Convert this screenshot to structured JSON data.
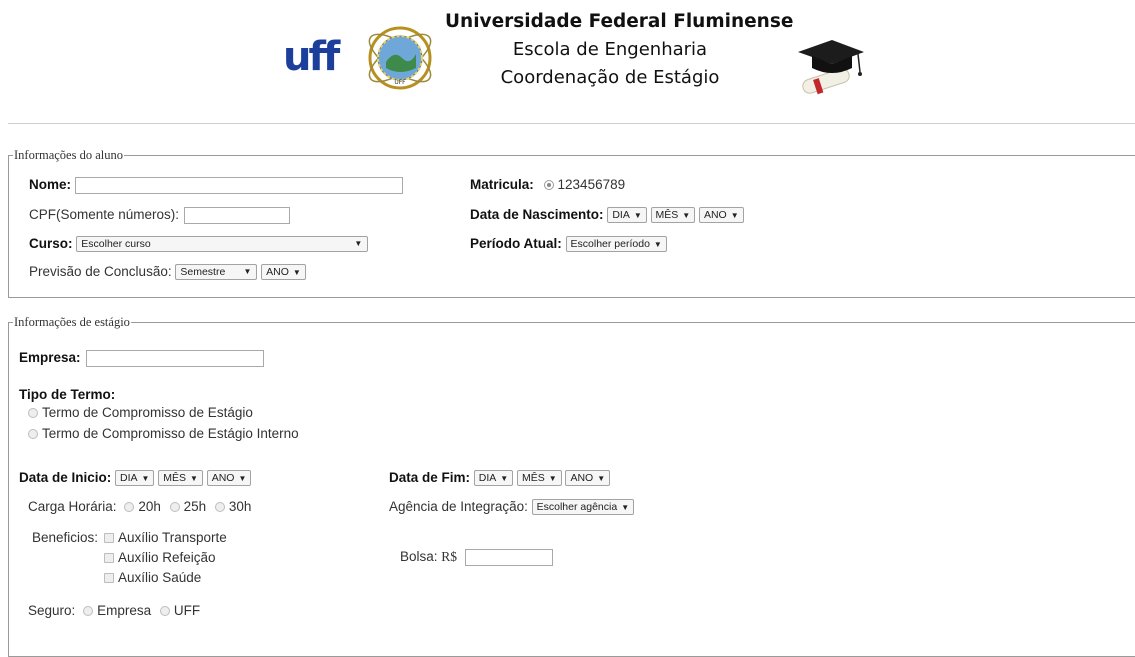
{
  "header": {
    "logo_text": "uff",
    "seal_text": "UFF",
    "lines": [
      "Universidade Federal Fluminense",
      "Escola de Engenharia",
      "Coordenação de Estágio"
    ]
  },
  "aluno": {
    "legend": "Informações do aluno",
    "nome_label": "Nome:",
    "nome_value": "",
    "matricula_label": "Matricula:",
    "matricula_value": "123456789",
    "cpf_label": "CPF(Somente números):",
    "cpf_value": "",
    "nascimento_label": "Data de Nascimento:",
    "nasc_dia": "DIA",
    "nasc_mes": "MÊS",
    "nasc_ano": "ANO",
    "curso_label": "Curso:",
    "curso_value": "Escolher curso",
    "periodo_label": "Período Atual:",
    "periodo_value": "Escolher período",
    "previsao_label": "Previsão de Conclusão:",
    "previsao_semestre": "Semestre",
    "previsao_ano": "ANO"
  },
  "estagio": {
    "legend": "Informações de estágio",
    "empresa_label": "Empresa:",
    "empresa_value": "",
    "tipo_label": "Tipo de Termo:",
    "tipo_options": [
      "Termo de Compromisso de Estágio",
      "Termo de Compromisso de Estágio Interno"
    ],
    "inicio_label": "Data de Inicio:",
    "inicio_dia": "DIA",
    "inicio_mes": "MÊS",
    "inicio_ano": "ANO",
    "fim_label": "Data de Fim:",
    "fim_dia": "DIA",
    "fim_mes": "MÊS",
    "fim_ano": "ANO",
    "carga_label": "Carga Horária:",
    "carga_options": [
      "20h",
      "25h",
      "30h"
    ],
    "agencia_label": "Agência de Integração:",
    "agencia_value": "Escolher agência",
    "beneficios_label": "Beneficios:",
    "beneficios_options": [
      "Auxílio Transporte",
      "Auxílio Refeição",
      "Auxílio Saúde"
    ],
    "bolsa_label": "Bolsa:",
    "bolsa_currency": "R$",
    "bolsa_value": "",
    "seguro_label": "Seguro:",
    "seguro_options": [
      "Empresa",
      "UFF"
    ]
  },
  "colors": {
    "uff_blue": "#1b3f9a",
    "border": "#9a9a9a"
  }
}
